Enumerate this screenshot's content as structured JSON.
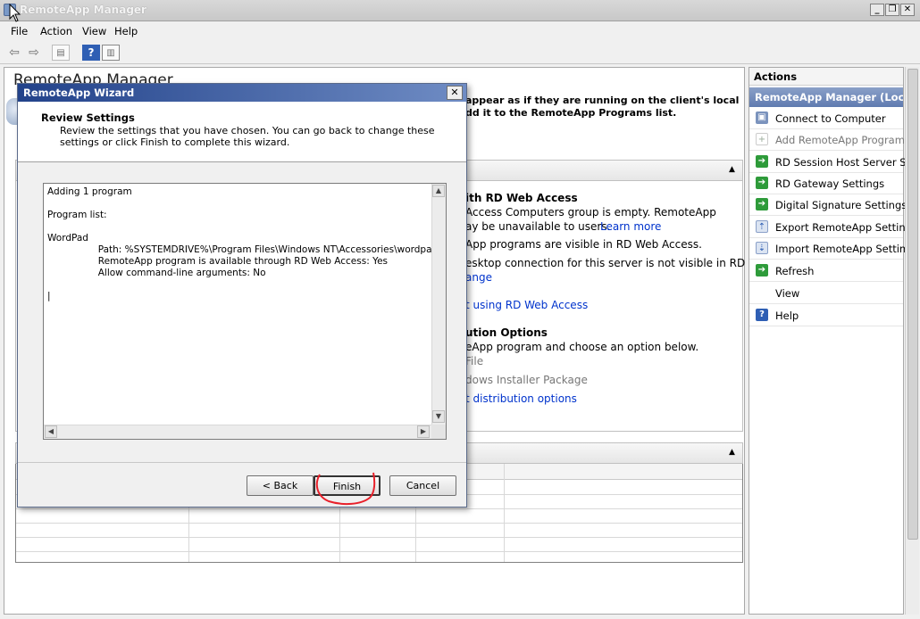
{
  "window": {
    "title": "RemoteApp Manager"
  },
  "menu": [
    "File",
    "Action",
    "View",
    "Help"
  ],
  "main": {
    "title": "RemoteApp Manager",
    "intro_line1": "appear as if they are running on the client's local",
    "intro_line2": "dd it to the RemoteApp Programs list.",
    "web_access": {
      "heading": "ith RD Web Access",
      "line1": "Access Computers group is empty. RemoteApp",
      "line2a": "ay be unavailable to users.",
      "learn_more": "Learn more",
      "line3": "App programs are visible in RD Web Access.",
      "line4": "esktop connection for this server is not visible in RD Web",
      "change_link": "ange",
      "using_link": "t using RD Web Access"
    },
    "distribution": {
      "heading": "ution Options",
      "line1": "eApp program and choose an option below.",
      "file": "File",
      "installer": "dows Installer Package",
      "options_link": "t distribution options"
    }
  },
  "actions": {
    "header": "Actions",
    "group": "RemoteApp Manager (Loc...",
    "items": [
      {
        "label": "Connect to Computer",
        "icon": "computer-icon",
        "enabled": true
      },
      {
        "label": "Add RemoteApp Programs",
        "icon": "add-program-icon",
        "enabled": false
      },
      {
        "label": "RD Session Host Server S...",
        "icon": "green-arrow-icon",
        "enabled": true
      },
      {
        "label": "RD Gateway Settings",
        "icon": "green-arrow-icon",
        "enabled": true
      },
      {
        "label": "Digital Signature Settings",
        "icon": "green-arrow-icon",
        "enabled": true
      },
      {
        "label": "Export RemoteApp Settings",
        "icon": "export-icon",
        "enabled": true
      },
      {
        "label": "Import RemoteApp Settings",
        "icon": "import-icon",
        "enabled": true
      },
      {
        "label": "Refresh",
        "icon": "refresh-icon",
        "enabled": true
      },
      {
        "label": "View",
        "icon": "",
        "enabled": true
      },
      {
        "label": "Help",
        "icon": "help-icon",
        "enabled": true
      }
    ]
  },
  "wizard": {
    "title": "RemoteApp Wizard",
    "close": "✕",
    "heading": "Review Settings",
    "description": "Review the settings that you have chosen. You can go back to change these settings or click Finish to complete this wizard.",
    "summary": "Adding 1 program\n\nProgram list:\n\nWordPad\n                 Path: %SYSTEMDRIVE%\\Program Files\\Windows NT\\Accessories\\wordpad.exe\n                 RemoteApp program is available through RD Web Access: Yes\n                 Allow command-line arguments: No\n\n|",
    "buttons": {
      "back": "< Back",
      "finish": "Finish",
      "cancel": "Cancel"
    }
  },
  "colors": {
    "accent": "#22428a",
    "link": "#0033cc",
    "annotation": "#e8202a"
  }
}
